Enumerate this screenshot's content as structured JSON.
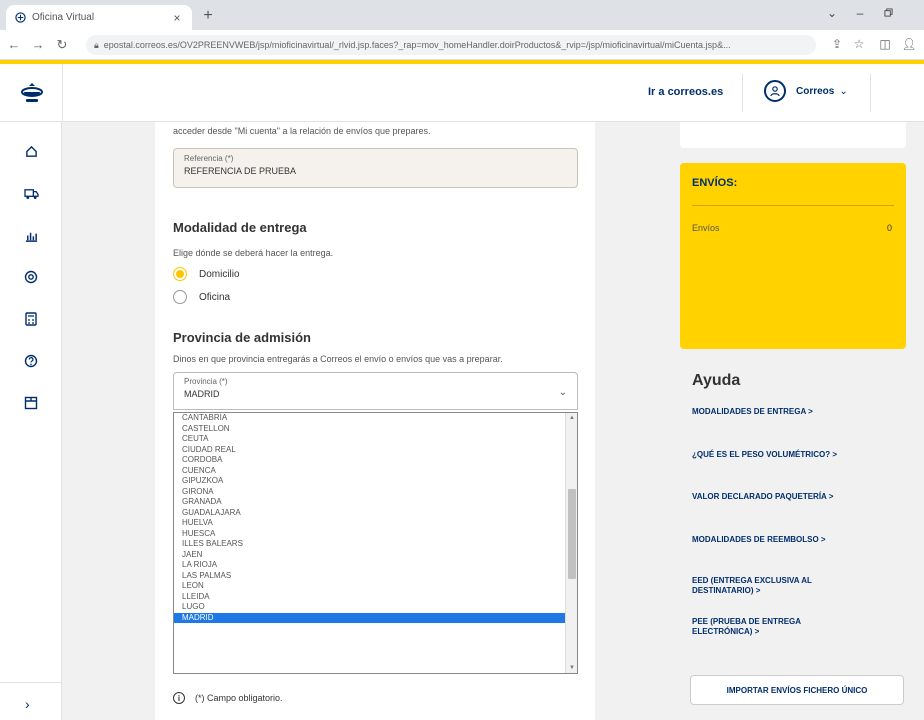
{
  "browser": {
    "tab_title": "Oficina Virtual",
    "tab_close": "×",
    "new_tab": "+",
    "url": "epostal.correos.es/OV2PREENVWEB/jsp/mioficinavirtual/_rlvid.jsp.faces?_rap=mov_homeHandler.doirProductos&_rvip=/jsp/mioficinavirtual/miCuenta.jsp&..."
  },
  "header": {
    "ir_link": "Ir a correos.es",
    "user_name": "Correos"
  },
  "form": {
    "intro_text": "acceder desde \"Mi cuenta\" a la relación de envíos que prepares.",
    "referencia": {
      "label": "Referencia (*)",
      "value": "REFERENCIA DE PRUEBA"
    },
    "modalidad": {
      "title": "Modalidad de entrega",
      "desc": "Elige dónde se deberá hacer la entrega.",
      "options": [
        "Domicilio",
        "Oficina"
      ],
      "selected": "Domicilio"
    },
    "provincia": {
      "title": "Provincia de admisión",
      "desc": "Dinos en que provincia entregarás a Correos el envío o envíos que vas a preparar.",
      "label": "Provincia (*)",
      "value": "MADRID",
      "options": [
        "CANTABRIA",
        "CASTELLON",
        "CEUTA",
        "CIUDAD REAL",
        "CORDOBA",
        "CUENCA",
        "GIPUZKOA",
        "GIRONA",
        "GRANADA",
        "GUADALAJARA",
        "HUELVA",
        "HUESCA",
        "ILLES BALEARS",
        "JAEN",
        "LA RIOJA",
        "LAS PALMAS",
        "LEON",
        "LLEIDA",
        "LUGO",
        "MADRID"
      ],
      "highlighted": "MADRID"
    },
    "required_note": "(*) Campo obligatorio."
  },
  "envios": {
    "title": "ENVÍOS:",
    "label": "Envíos",
    "value": "0",
    "accent": "#ffd200"
  },
  "help": {
    "title": "Ayuda",
    "links": [
      {
        "l1": "MODALIDADES DE ENTREGA  >",
        "l2": ""
      },
      {
        "l1": "¿QUÉ ES EL PESO VOLUMÉTRICO?  >",
        "l2": ""
      },
      {
        "l1": "VALOR DECLARADO PAQUETERÍA  >",
        "l2": ""
      },
      {
        "l1": "MODALIDADES DE REEMBOLSO  >",
        "l2": ""
      },
      {
        "l1": "EED (ENTREGA EXCLUSIVA AL",
        "l2": "DESTINATARIO)  >"
      },
      {
        "l1": "PEE (PRUEBA DE ENTREGA",
        "l2": "ELECTRÓNICA)  >"
      }
    ],
    "import_button": "IMPORTAR ENVÍOS FICHERO ÚNICO"
  },
  "icons": {
    "brand": "correos-logo-icon",
    "sidebar": [
      "home-icon",
      "truck-icon",
      "chart-icon",
      "settings-icon",
      "calculator-icon",
      "help-icon",
      "package-icon"
    ]
  }
}
